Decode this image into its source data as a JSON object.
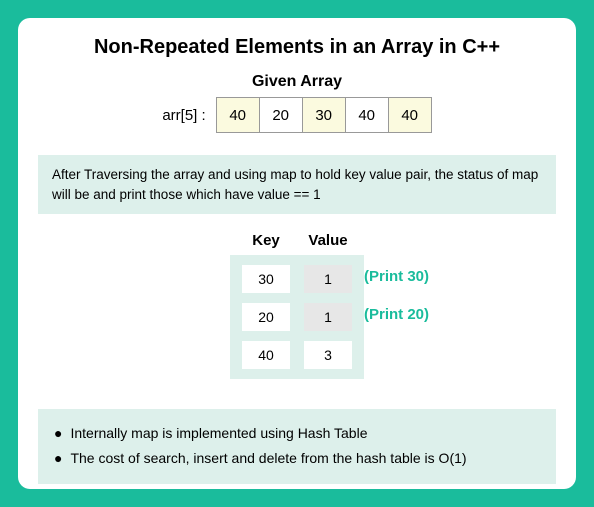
{
  "title": "Non-Repeated Elements in an Array in C++",
  "given_array_label": "Given Array",
  "arr_label": "arr[5] :",
  "array_cells": [
    "40",
    "20",
    "30",
    "40",
    "40"
  ],
  "explain_text": "After Traversing the array and using map to hold key value pair, the status of map will be and print those which have value == 1",
  "map_headers": {
    "key": "Key",
    "value": "Value"
  },
  "map_rows": [
    {
      "key": "30",
      "value": "1",
      "print": "(Print 30)"
    },
    {
      "key": "20",
      "value": "1",
      "print": "(Print 20)"
    },
    {
      "key": "40",
      "value": "3",
      "print": ""
    }
  ],
  "notes": [
    "Internally map is implemented using Hash Table",
    "The cost of search, insert and delete from the hash table is O(1)"
  ],
  "chart_data": {
    "type": "table",
    "title": "Non-Repeated Elements in an Array in C++",
    "input_array": [
      40,
      20,
      30,
      40,
      40
    ],
    "map_state": [
      {
        "key": 30,
        "value": 1,
        "action": "Print 30"
      },
      {
        "key": 20,
        "value": 1,
        "action": "Print 20"
      },
      {
        "key": 40,
        "value": 3,
        "action": ""
      }
    ],
    "output_non_repeated": [
      30,
      20
    ],
    "notes": [
      "Internally map is implemented using Hash Table",
      "The cost of search, insert and delete from the hash table is O(1)"
    ]
  }
}
